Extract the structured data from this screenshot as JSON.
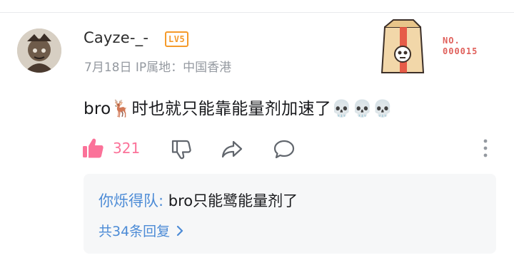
{
  "comment": {
    "username": "Cayze-_-",
    "level_badge": "LV5",
    "meta": "7月18日 IP属地：中国香港",
    "fan_label": "NO.",
    "fan_number": "000015",
    "content": "bro🦌时也就只能靠能量剂加速了💀💀💀",
    "like_count": "321"
  },
  "reply_preview": {
    "author": "你烁得队:",
    "text": " bro只能鹭能量剂了",
    "more_label": "共34条回复"
  },
  "colors": {
    "accent_pink": "#fb7299",
    "link_blue": "#4c8bd6",
    "level_orange": "#f59a2a",
    "fan_red": "#e0605b"
  },
  "icons": [
    "avatar",
    "level-badge",
    "fan-card-bag",
    "thumbs-up-icon",
    "thumbs-down-icon",
    "share-icon",
    "reply-bubble-icon",
    "more-dots-icon",
    "chevron-right-icon"
  ]
}
